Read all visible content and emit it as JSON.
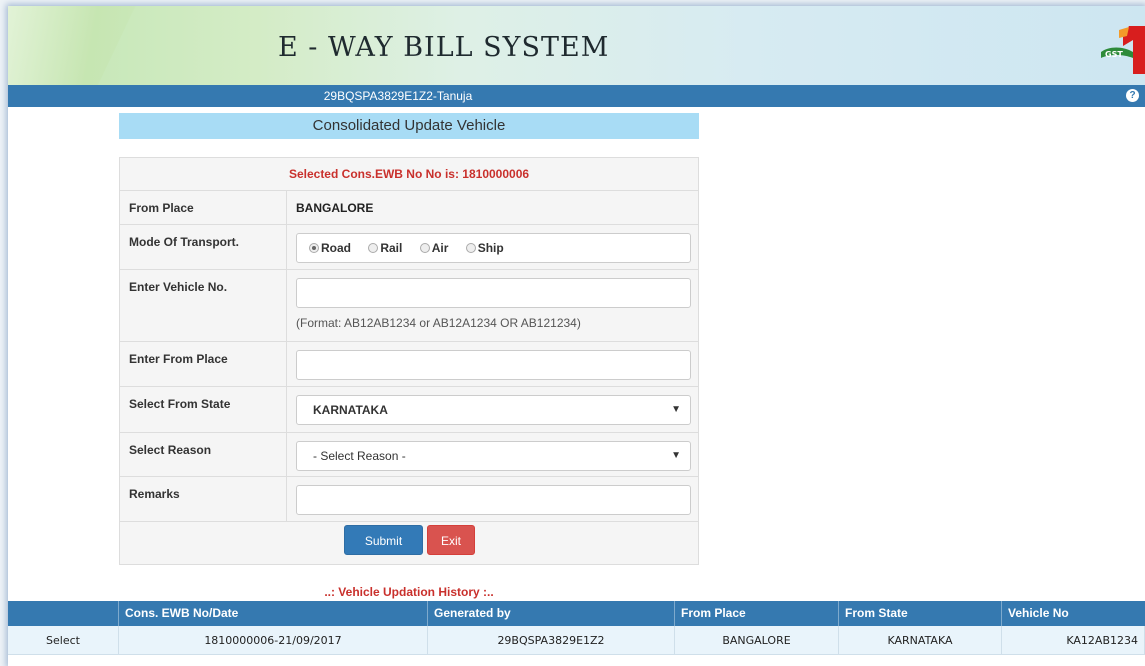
{
  "header": {
    "title": "E - WAY BILL SYSTEM",
    "logo_text": "GST"
  },
  "userbar": {
    "user": "29BQSPA3829E1Z2-Tanuja",
    "help_icon": "?"
  },
  "form": {
    "title": "Consolidated Update Vehicle",
    "caption": "Selected Cons.EWB No No is: 1810000006",
    "from_place_label": "From Place",
    "from_place_value": "BANGALORE",
    "mode_label": "Mode Of Transport.",
    "modes": [
      "Road",
      "Rail",
      "Air",
      "Ship"
    ],
    "selected_mode": "Road",
    "vehicle_label": "Enter Vehicle No.",
    "vehicle_value": "",
    "vehicle_hint": "(Format: AB12AB1234 or AB12A1234 OR AB121234)",
    "enter_from_place_label": "Enter From Place",
    "enter_from_place_value": "",
    "state_label": "Select From State",
    "state_value": "KARNATAKA",
    "reason_label": "Select Reason",
    "reason_value": "- Select Reason -",
    "remarks_label": "Remarks",
    "remarks_value": "",
    "submit_label": "Submit",
    "exit_label": "Exit"
  },
  "history": {
    "title": "..: Vehicle Updation History :..",
    "columns": [
      "",
      "Cons. EWB No/Date",
      "Generated by",
      "From Place",
      "From State",
      "Vehicle No"
    ],
    "rows": [
      [
        "Select",
        "1810000006-21/09/2017",
        "29BQSPA3829E1Z2",
        "BANGALORE",
        "KARNATAKA",
        "KA12AB1234"
      ]
    ]
  },
  "colors": {
    "primary": "#3579b0",
    "danger": "#c9302c",
    "title_bg": "#a8dcf5"
  }
}
